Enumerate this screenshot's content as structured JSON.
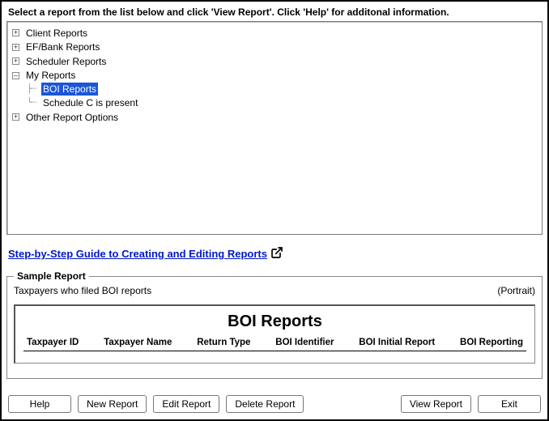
{
  "instructions": "Select a report from the list below and click 'View Report'. Click 'Help' for additonal information.",
  "tree": {
    "client": "Client Reports",
    "efbank": "EF/Bank Reports",
    "scheduler": "Scheduler Reports",
    "myreports": "My Reports",
    "myreports_children": {
      "boi": "BOI Reports",
      "schedc": "Schedule C is present"
    },
    "other": "Other Report Options"
  },
  "guide": {
    "text": "Step-by-Step Guide to Creating and Editing Reports"
  },
  "sample": {
    "legend": "Sample Report",
    "desc": "Taxpayers who filed BOI reports",
    "orientation": "(Portrait)",
    "title": "BOI Reports",
    "columns": [
      "Taxpayer ID",
      "Taxpayer Name",
      "Return Type",
      "BOI Identifier",
      "BOI Initial Report",
      "BOI Reporting"
    ]
  },
  "buttons": {
    "help": "Help",
    "new": "New Report",
    "edit": "Edit Report",
    "delete": "Delete Report",
    "view": "View Report",
    "exit": "Exit"
  }
}
